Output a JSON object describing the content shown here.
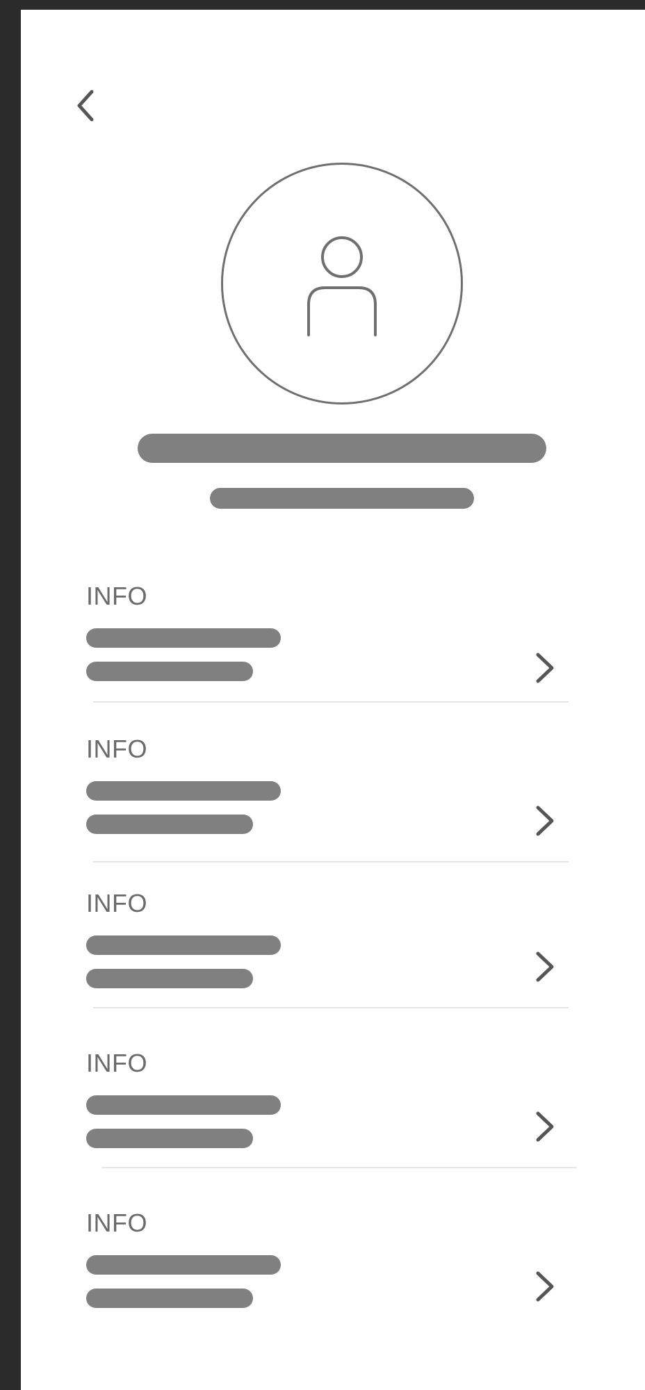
{
  "header": {
    "back_icon": "chevron-left-icon"
  },
  "profile": {
    "avatar_icon": "person-icon"
  },
  "info_items": [
    {
      "label": "INFO",
      "icon": "chevron-right-icon"
    },
    {
      "label": "INFO",
      "icon": "chevron-right-icon"
    },
    {
      "label": "INFO",
      "icon": "chevron-right-icon"
    },
    {
      "label": "INFO",
      "icon": "chevron-right-icon"
    },
    {
      "label": "INFO",
      "icon": "chevron-right-icon"
    }
  ],
  "colors": {
    "background": "#2b2b2b",
    "surface": "#ffffff",
    "placeholder": "#808080",
    "label": "#6a6a6a",
    "divider": "#e6e6e6"
  }
}
